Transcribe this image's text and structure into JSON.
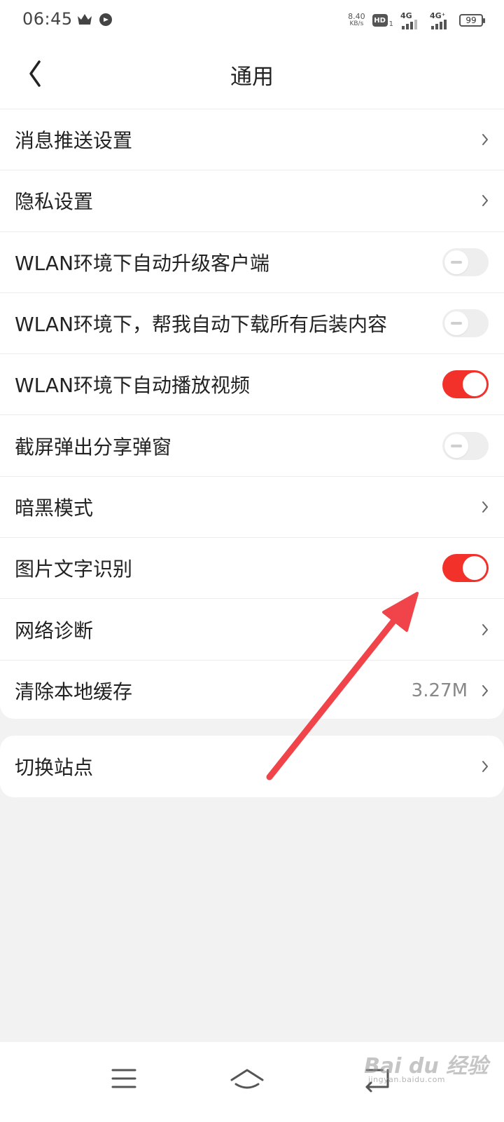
{
  "status_bar": {
    "time": "06:45",
    "icons": [
      "crown-icon",
      "message-bubble-icon"
    ],
    "net_speed_value": "8.40",
    "net_speed_unit": "KB/s",
    "hd_badge": "HD",
    "hd_sub": "1",
    "sim1_label": "4G",
    "sim2_label": "4G⁺",
    "battery": "99"
  },
  "header": {
    "title": "通用",
    "back_icon": "chevron-left-icon"
  },
  "settings": [
    {
      "label": "消息推送设置",
      "type": "link"
    },
    {
      "label": "隐私设置",
      "type": "link"
    },
    {
      "label": "WLAN环境下自动升级客户端",
      "type": "toggle",
      "on": false
    },
    {
      "label": "WLAN环境下，帮我自动下载所有后装内容",
      "type": "toggle",
      "on": false
    },
    {
      "label": "WLAN环境下自动播放视频",
      "type": "toggle",
      "on": true
    },
    {
      "label": "截屏弹出分享弹窗",
      "type": "toggle",
      "on": false
    },
    {
      "label": "暗黑模式",
      "type": "link"
    },
    {
      "label": "图片文字识别",
      "type": "toggle",
      "on": true
    },
    {
      "label": "网络诊断",
      "type": "link"
    },
    {
      "label": "清除本地缓存",
      "type": "link",
      "value": "3.27M"
    }
  ],
  "site_switch": {
    "label": "切换站点",
    "type": "link"
  },
  "navbar": {
    "items": [
      "menu-icon",
      "home-icon",
      "back-icon"
    ]
  },
  "watermark": {
    "text": "Bai du 经验",
    "sub": "jingyan.baidu.com"
  },
  "colors": {
    "accent": "#f2312a",
    "annotation_arrow": "#f0434a",
    "background": "#f2f2f2"
  }
}
